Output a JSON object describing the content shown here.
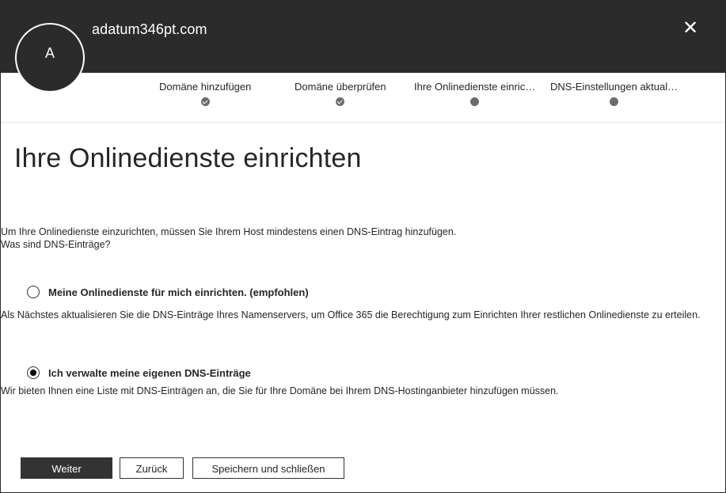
{
  "header": {
    "avatar_initial": "A",
    "domain": "adatum346pt.com",
    "close_glyph": "✕"
  },
  "stepper": {
    "steps": [
      {
        "label": "Domäne hinzufügen",
        "state": "completed"
      },
      {
        "label": "Domäne überprüfen",
        "state": "completed"
      },
      {
        "label": "Ihre Onlinedienste einric…",
        "state": "current"
      },
      {
        "label": "DNS-Einstellungen aktual…",
        "state": "pending"
      }
    ]
  },
  "main": {
    "title": "Ihre Onlinedienste einrichten",
    "intro_text": "Um Ihre Onlinedienste einzurichten, müssen Sie Ihrem Host mindestens einen DNS-Eintrag hinzufügen.",
    "help_link": "Was sind DNS-Einträge?",
    "options": [
      {
        "label": "Meine Onlinedienste für mich einrichten. (empfohlen)",
        "description": "Als Nächstes aktualisieren Sie die DNS-Einträge Ihres Namenservers, um Office 365 die Berechtigung zum Einrichten Ihrer restlichen Onlinedienste zu erteilen.",
        "selected": false
      },
      {
        "label": "Ich verwalte meine eigenen DNS-Einträge",
        "description": "Wir bieten Ihnen eine Liste mit DNS-Einträgen an, die Sie für Ihre Domäne bei Ihrem DNS-Hostinganbieter hinzufügen müssen.",
        "selected": true
      }
    ]
  },
  "buttons": {
    "next": "Weiter",
    "back": "Zurück",
    "save_close": "Speichern und schließen"
  },
  "colors": {
    "header_bg": "#2b2b2b",
    "primary_button": "#333333",
    "step_dot": "#6b6b6b"
  },
  "icons": {
    "close": "close-icon",
    "step_completed": "checkmark-icon",
    "step_pending": "dot-icon"
  }
}
